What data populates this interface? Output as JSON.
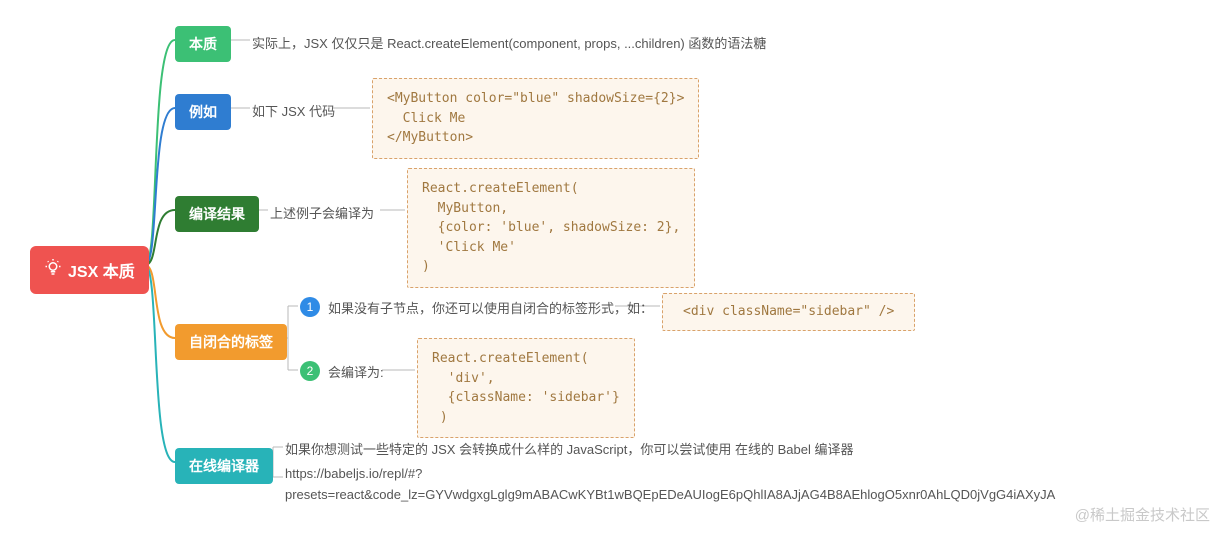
{
  "root": {
    "title": "JSX 本质"
  },
  "branches": {
    "essence": {
      "label": "本质",
      "text": "实际上，JSX 仅仅只是 React.createElement(component, props, ...children) 函数的语法糖"
    },
    "example": {
      "label": "例如",
      "text": "如下 JSX 代码",
      "code": "<MyButton color=\"blue\" shadowSize={2}>\n  Click Me\n</MyButton>"
    },
    "compiled": {
      "label": "编译结果",
      "text": "上述例子会编译为",
      "code": "React.createElement(\n  MyButton,\n  {color: 'blue', shadowSize: 2},\n  'Click Me'\n)"
    },
    "selfclosing": {
      "label": "自闭合的标签",
      "item1": {
        "num": "1",
        "text": "如果没有子节点，你还可以使用自闭合的标签形式，如：",
        "code": "<div className=\"sidebar\" />"
      },
      "item2": {
        "num": "2",
        "text": "会编译为:",
        "code": "React.createElement(\n  'div',\n  {className: 'sidebar'}\n )"
      }
    },
    "online": {
      "label": "在线编译器",
      "line1": "如果你想测试一些特定的 JSX 会转换成什么样的 JavaScript，你可以尝试使用 在线的 Babel 编译器",
      "line2": "https://babeljs.io/repl/#?presets=react&code_lz=GYVwdgxgLglg9mABACwKYBt1wBQEpEDeAUIogE6pQhlIA8AJjAG4B8AEhlogO5xnr0AhLQD0jVgG4iAXyJA"
    }
  },
  "watermark": "@稀土掘金技术社区"
}
